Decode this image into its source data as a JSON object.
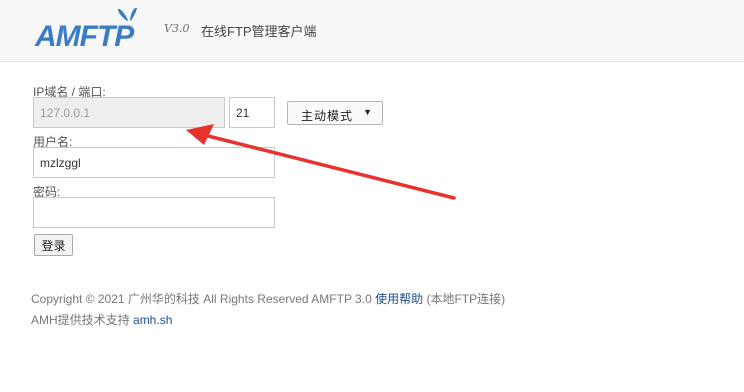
{
  "header": {
    "logo_text": "AMFTP",
    "version": "V3.0",
    "tagline": "在线FTP管理客户端"
  },
  "form": {
    "host_label": "IP域名 / 端口:",
    "host_value": "127.0.0.1",
    "port_value": "21",
    "mode_selected": "主动模式",
    "username_label": "用户名:",
    "username_value": "mzlzggl",
    "password_label": "密码:",
    "password_value": "",
    "login_label": "登录"
  },
  "footer": {
    "copyright": "Copyright © 2021 广州华的科技 All Rights Reserved AMFTP 3.0",
    "help_link": "使用帮助",
    "local_note": "(本地FTP连接)",
    "support_text": "AMH提供技术支持",
    "support_link": "amh.sh"
  },
  "annotation": {
    "arrow_color": "#e8322e"
  },
  "colors": {
    "logo_blue": "#3b7dc4",
    "link_blue": "#1f4f8c"
  }
}
